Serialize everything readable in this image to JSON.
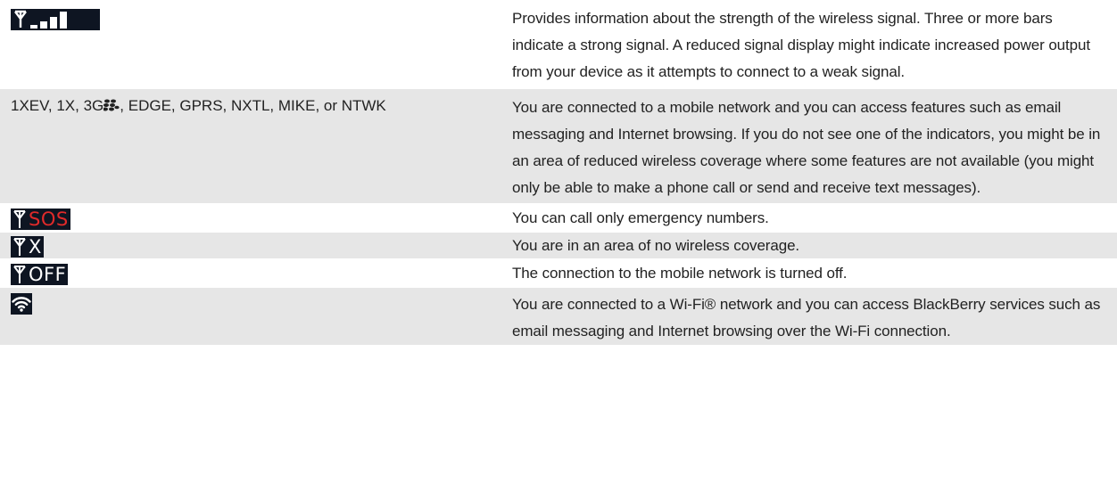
{
  "rows": [
    {
      "icon": "signal-strength-icon",
      "description": "Provides information about the strength of the wireless signal. Three or more bars indicate a strong signal. A reduced signal display might indicate increased power output from your device as it attempts to connect to a weak signal."
    },
    {
      "indicator_prefix": "1XEV, 1X, 3G",
      "indicator_logo": "blackberry-logo-icon",
      "indicator_suffix": ", EDGE, GPRS, NXTL, MIKE, or NTWK",
      "description": "You are connected to a mobile network and you can access features such as email messaging and Internet browsing. If you do not see one of the indicators, you might be in an area of reduced wireless coverage where some features are not available (you might only be able to make a phone call or send and receive text messages)."
    },
    {
      "icon": "antenna-icon",
      "status_text": "SOS",
      "status_color": "#e02a2a",
      "description": "You can call only emergency numbers."
    },
    {
      "icon": "antenna-icon",
      "status_text": "X",
      "status_color": "#ffffff",
      "description": "You are in an area of no wireless coverage."
    },
    {
      "icon": "antenna-icon",
      "status_text": "OFF",
      "status_color": "#ffffff",
      "description": "The connection to the mobile network is turned off."
    },
    {
      "icon": "wifi-icon",
      "description": "You are connected to a Wi-Fi® network and you can access BlackBerry services such as email messaging and Internet browsing over the Wi-Fi connection."
    }
  ],
  "colors": {
    "row_shade": "#e6e6e6",
    "icon_background": "#0e1522",
    "icon_foreground": "#ffffff",
    "sos_red": "#e02a2a"
  }
}
